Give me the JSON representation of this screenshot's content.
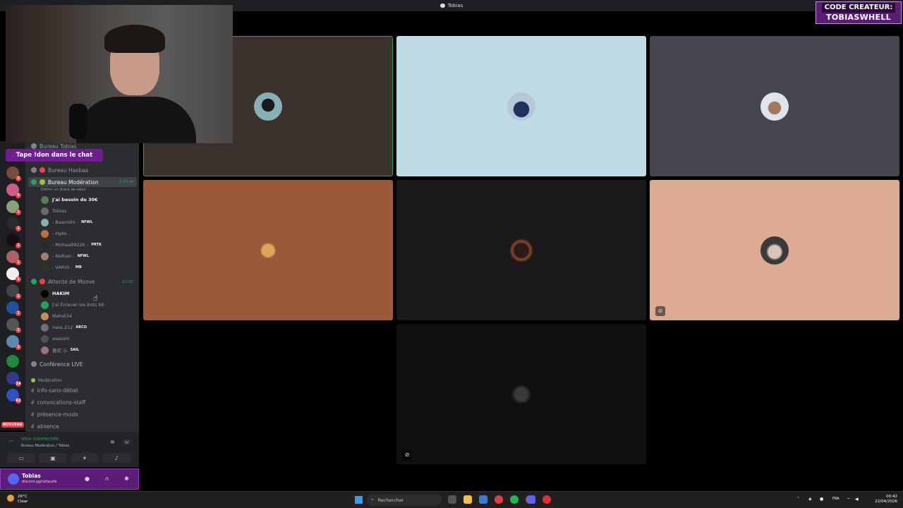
{
  "window": {
    "title": "Tobias"
  },
  "creator_code": {
    "line1": "CODE CREATEUR:",
    "line2": "TOBIASWHELL"
  },
  "banner": {
    "text": "Tape !don dans le chat"
  },
  "sidebar": {
    "hidden_top": "Bureau Tobias",
    "channels": [
      {
        "name": "Bureau Hasbaa"
      },
      {
        "name": "Bureau Modération",
        "timer": "1:23:44",
        "status": "Définir un statut de salon"
      }
    ],
    "moderation_users": [
      {
        "name": "J'ai besoin de 30€",
        "tag": ""
      },
      {
        "name": "Tobias",
        "tag": ""
      },
      {
        "name": "- Baaroshi -",
        "tag": "NFWL"
      },
      {
        "name": "- Hyko -",
        "tag": ""
      },
      {
        "name": "- Mohaa9922K -",
        "tag": "PRTK"
      },
      {
        "name": "- Nolhan -",
        "tag": "NFWL"
      },
      {
        "name": "- VARIO -",
        "tag": "MB"
      }
    ],
    "waiting_channel": {
      "name": "Attente de Moove",
      "timer": "25:31"
    },
    "waiting_users": [
      {
        "name": "HAKIM",
        "tag": ""
      },
      {
        "name": "J'ai Enlever les bots bb",
        "tag": ""
      },
      {
        "name": "Mehdi34",
        "tag": ""
      },
      {
        "name": "nass.212",
        "tag": "ARCO"
      },
      {
        "name": "wassim",
        "tag": ""
      },
      {
        "name": "喜欢 ら",
        "tag": "SAIL"
      }
    ],
    "conference": "Conférence LIVE",
    "category": "Modération",
    "text_channels": [
      "info-sans-débat",
      "convocations-staff",
      "présence-modo",
      "absence"
    ]
  },
  "voice_panel": {
    "title": "Voix connectée",
    "subtitle": "Bureau Modération / Tobias"
  },
  "user_panel": {
    "name": "Tobias",
    "status": "discord.gg/nofacefa"
  },
  "server_badges": [
    "2",
    "5",
    "1",
    "1",
    "1",
    "1",
    "1",
    "1",
    "1",
    "1",
    "1",
    "14",
    "62"
  ],
  "server_new_label": "NOUVEAU",
  "taskbar": {
    "weather_temp": "26°C",
    "weather_desc": "Clear",
    "search_placeholder": "Rechercher",
    "language": "FRA",
    "time": "00:42",
    "date": "22/04/2026"
  },
  "colors": {
    "accent_purple": "#5b1d75",
    "tile1": "#3a312c",
    "tile2": "#c0dbe6",
    "tile3": "#44454e",
    "tile4": "#9a5a38",
    "tile5": "#19191b",
    "tile6": "#dcab92",
    "tile7": "#101010",
    "speaking": "#23a559"
  }
}
